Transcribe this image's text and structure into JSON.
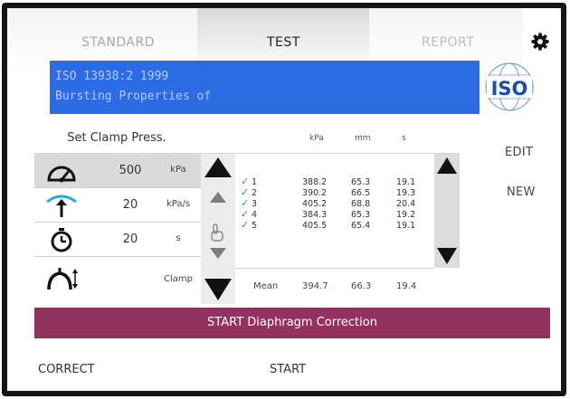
{
  "tabs": [
    {
      "label": "STANDARD"
    },
    {
      "label": "TEST"
    },
    {
      "label": "REPORT"
    }
  ],
  "icons": {
    "settings": "gear-icon",
    "logo": "iso-logo"
  },
  "standard": {
    "line1": "ISO 13938:2 1999",
    "line2": "Bursting Properties of",
    "logo_text": "ISO"
  },
  "params": {
    "header": "Set Clamp Press.",
    "rows": [
      {
        "icon": "gauge-icon",
        "value": "500",
        "unit": "kPa"
      },
      {
        "icon": "rate-arrow-icon",
        "value": "20",
        "unit": "kPa/s"
      },
      {
        "icon": "timer-icon",
        "value": "20",
        "unit": "s"
      },
      {
        "icon": "clamp-icon",
        "value": "",
        "unit": "Clamp"
      }
    ]
  },
  "results": {
    "columns": [
      "kPa",
      "mm",
      "s"
    ],
    "rows": [
      {
        "n": "1",
        "kpa": "388.2",
        "mm": "65.3",
        "s": "19.1"
      },
      {
        "n": "2",
        "kpa": "390.2",
        "mm": "66.5",
        "s": "19.3"
      },
      {
        "n": "3",
        "kpa": "405.2",
        "mm": "68.8",
        "s": "20.4"
      },
      {
        "n": "4",
        "kpa": "384.3",
        "mm": "65.3",
        "s": "19.2"
      },
      {
        "n": "5",
        "kpa": "405.5",
        "mm": "65.4",
        "s": "19.1"
      }
    ],
    "mean": {
      "label": "Mean",
      "kpa": "394.7",
      "mm": "66.3",
      "s": "19.4"
    }
  },
  "actions": {
    "edit": "EDIT",
    "new": "NEW",
    "start_correction": "START Diaphragm Correction",
    "correct": "CORRECT",
    "start": "START"
  },
  "colors": {
    "banner": "#2b6ce5",
    "start_bar": "#93325e",
    "check": "#2ea63a"
  }
}
